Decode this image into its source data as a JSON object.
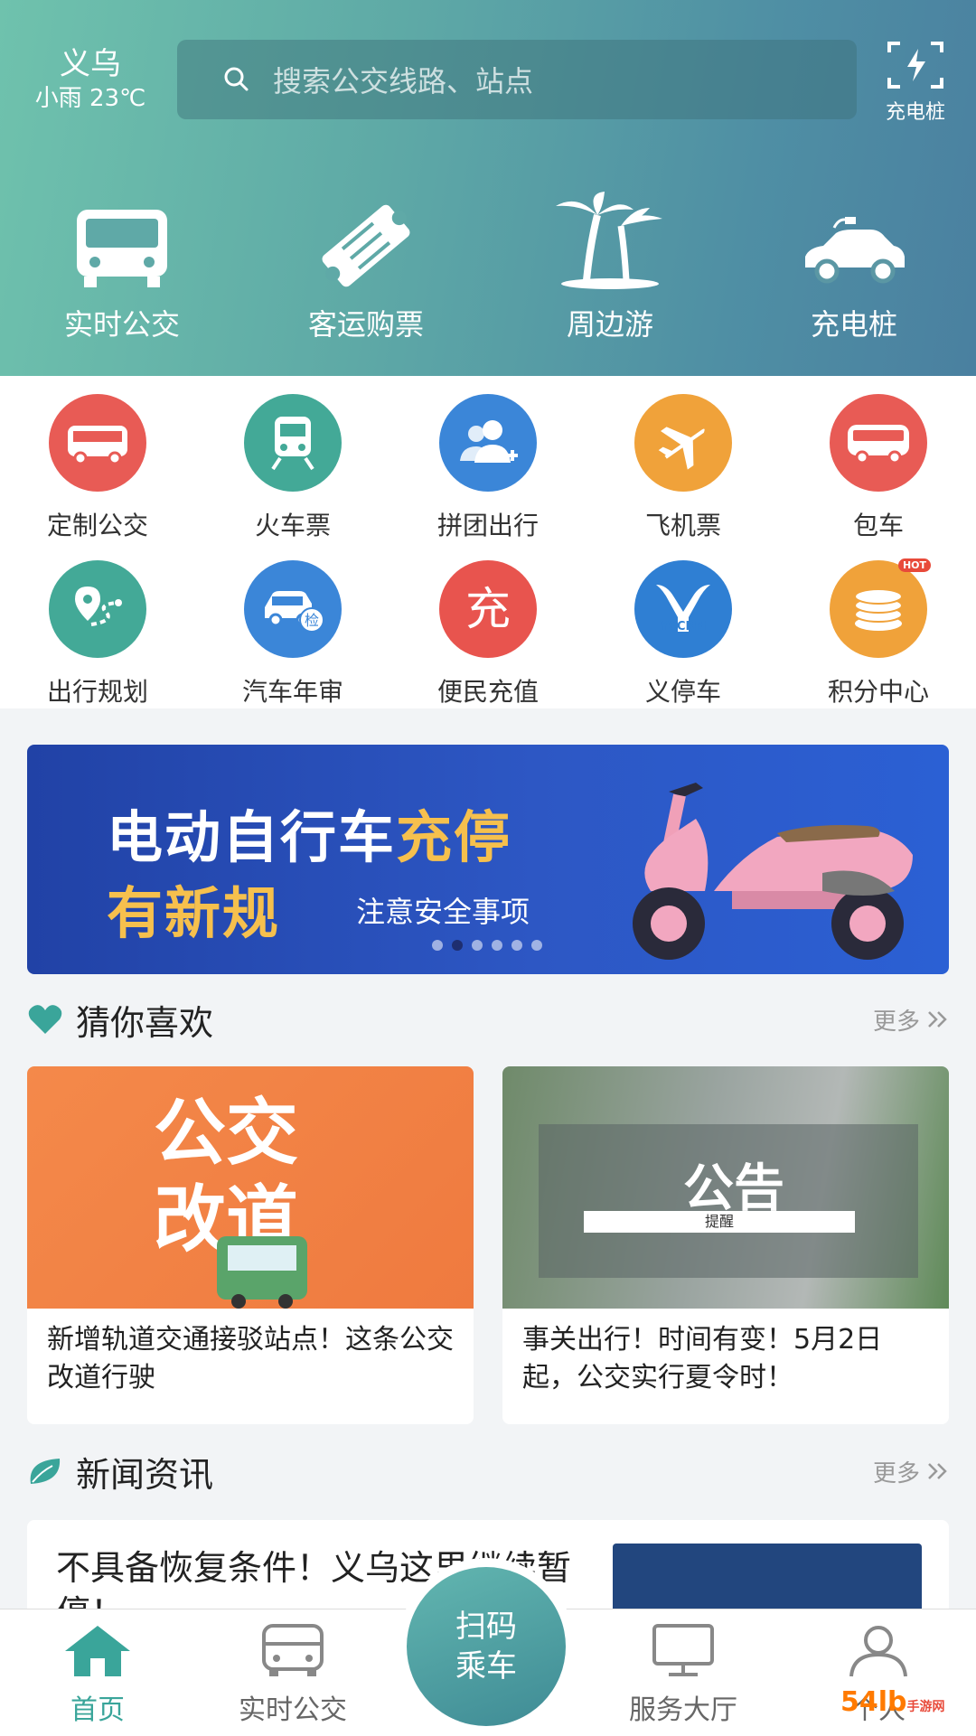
{
  "header": {
    "city": "义乌",
    "weather": "小雨 23℃",
    "search_placeholder": "搜索公交线路、站点",
    "charge_label": "充电桩"
  },
  "main_nav": [
    {
      "label": "实时公交",
      "icon": "bus-icon"
    },
    {
      "label": "客运购票",
      "icon": "ticket-icon"
    },
    {
      "label": "周边游",
      "icon": "palm-tree-icon"
    },
    {
      "label": "充电桩",
      "icon": "ev-car-icon"
    }
  ],
  "grid": [
    {
      "label": "定制公交",
      "icon": "custom-bus-icon",
      "color": "#e85b55"
    },
    {
      "label": "火车票",
      "icon": "train-icon",
      "color": "#43a997"
    },
    {
      "label": "拼团出行",
      "icon": "group-travel-icon",
      "color": "#3b86d8"
    },
    {
      "label": "飞机票",
      "icon": "airplane-icon",
      "color": "#f0a23a"
    },
    {
      "label": "包车",
      "icon": "charter-bus-icon",
      "color": "#e85b55"
    },
    {
      "label": "出行规划",
      "icon": "route-plan-icon",
      "color": "#43a997"
    },
    {
      "label": "汽车年审",
      "icon": "car-inspection-icon",
      "color": "#3b86d8",
      "badge": "检"
    },
    {
      "label": "便民充值",
      "icon": "recharge-icon",
      "color": "#e8544e",
      "badge": "充"
    },
    {
      "label": "义停车",
      "icon": "parking-logo-icon",
      "color": "#2f7fd3",
      "badge": "YCCRM"
    },
    {
      "label": "积分中心",
      "icon": "coins-icon",
      "color": "#f0a23a",
      "hot": "HOT"
    }
  ],
  "banner": {
    "line1_a": "电动自行车",
    "line1_b": "充停",
    "line2": "有新规",
    "line3": "注意安全事项",
    "slides": 6,
    "active_slide": 2
  },
  "guess": {
    "title": "猜你喜欢",
    "more": "更多",
    "cards": [
      {
        "img_text_1": "公交",
        "img_text_2": "改道",
        "text": "新增轨道交通接驳站点！这条公交改道行驶"
      },
      {
        "img_text": "公告",
        "img_sub": "提醒",
        "text": "事关出行！时间有变！5月2日起，公交实行夏令时！"
      }
    ]
  },
  "news": {
    "title": "新闻资讯",
    "more": "更多",
    "item_title": "不具备恢复条件！义乌这里继续暂停！"
  },
  "tabbar": {
    "tabs": [
      {
        "label": "首页",
        "icon": "home-icon"
      },
      {
        "label": "实时公交",
        "icon": "bus-icon"
      },
      {
        "label": "",
        "icon": ""
      },
      {
        "label": "服务大厅",
        "icon": "monitor-icon"
      },
      {
        "label": "个人",
        "icon": "user-icon"
      }
    ],
    "scan_line1": "扫码",
    "scan_line2": "乘车"
  },
  "watermark": {
    "text": "54lb",
    "sub": "手游网"
  },
  "colors": {
    "accent": "#3aa59a",
    "header_start": "#6fc2ad",
    "header_end": "#4a80a0"
  }
}
